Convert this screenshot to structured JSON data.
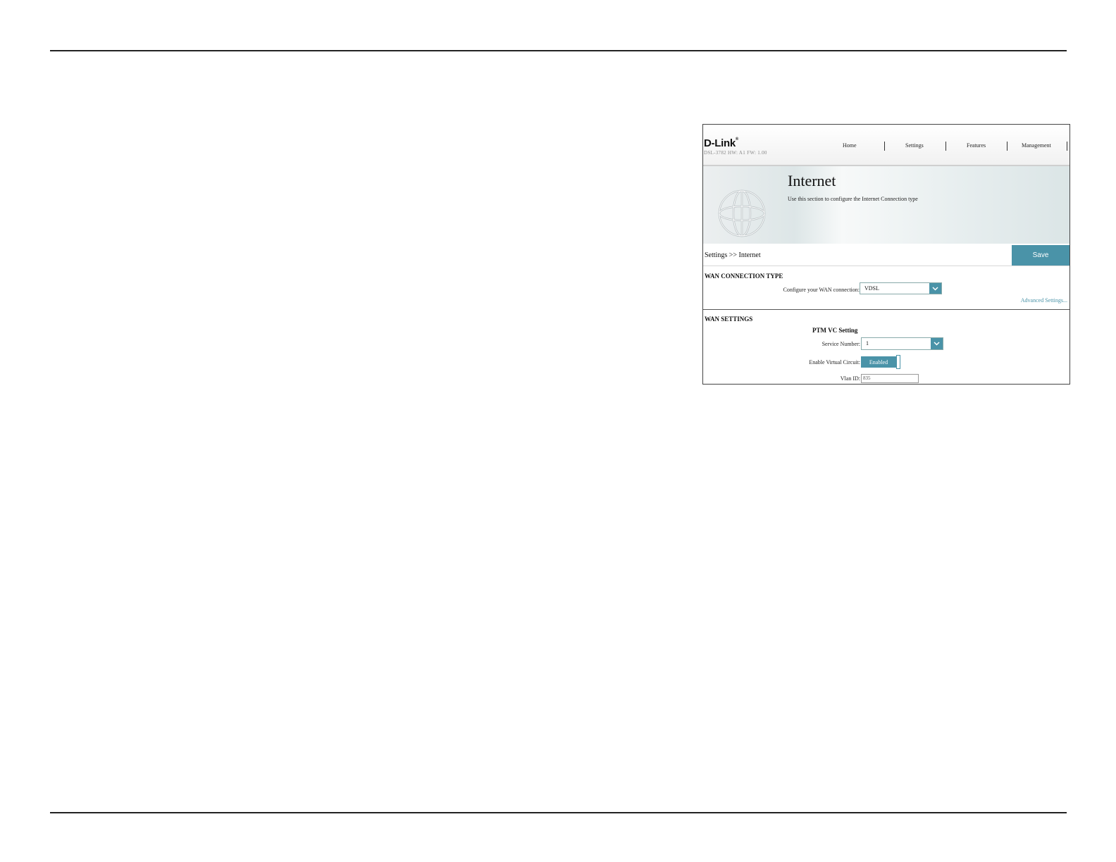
{
  "router_ui": {
    "brand": "D-Link",
    "brand_mark": "®",
    "model_info": "DSL-3782  HW: A1  FW: 1.00",
    "nav": [
      "Home",
      "Settings",
      "Features",
      "Management"
    ],
    "page_title": "Internet",
    "page_description": "Use this section to configure the Internet Connection type",
    "breadcrumb": "Settings >> Internet",
    "save_label": "Save",
    "wan_connection_type": {
      "title": "WAN CONNECTION TYPE",
      "label": "Configure your WAN connection:",
      "value": "VDSL",
      "advanced_link": "Advanced Settings..."
    },
    "wan_settings": {
      "title": "WAN SETTINGS",
      "subtitle": "PTM VC Setting",
      "service_number_label": "Service Number:",
      "service_number_value": "1",
      "enable_vc_label": "Enable Virtual Circuit:",
      "enable_vc_value": "Enabled",
      "vlan_label": "Vlan ID:",
      "vlan_value": "835"
    },
    "colors": {
      "accent": "#4a93a8"
    }
  }
}
